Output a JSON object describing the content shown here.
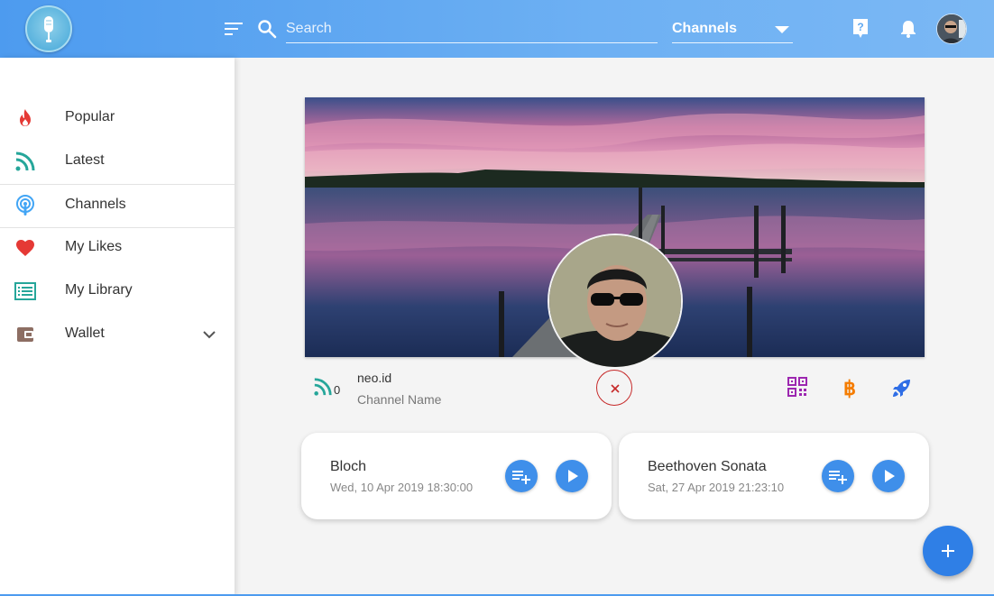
{
  "app": {
    "brand_color": "#4d9bef"
  },
  "header": {
    "search": {
      "placeholder": "Search",
      "value": ""
    },
    "filter": {
      "selected": "Channels"
    }
  },
  "sidebar": {
    "items": [
      {
        "label": "Popular",
        "icon": "fire-icon",
        "color": "#e53935"
      },
      {
        "label": "Latest",
        "icon": "rss-icon",
        "color": "#26a69a"
      },
      {
        "label": "Channels",
        "icon": "podcast-icon",
        "color": "#42a5f5"
      },
      {
        "label": "My Likes",
        "icon": "heart-icon",
        "color": "#e53935"
      },
      {
        "label": "My Library",
        "icon": "library-icon",
        "color": "#26a69a"
      },
      {
        "label": "Wallet",
        "icon": "wallet-icon",
        "color": "#8d6e63"
      }
    ]
  },
  "channel": {
    "subscriber_count": "0",
    "id": "neo.id",
    "name_label": "Channel Name"
  },
  "episodes": [
    {
      "title": "Bloch",
      "date": "Wed, 10 Apr 2019 18:30:00"
    },
    {
      "title": "Beethoven Sonata",
      "date": "Sat, 27 Apr 2019 21:23:10"
    }
  ]
}
